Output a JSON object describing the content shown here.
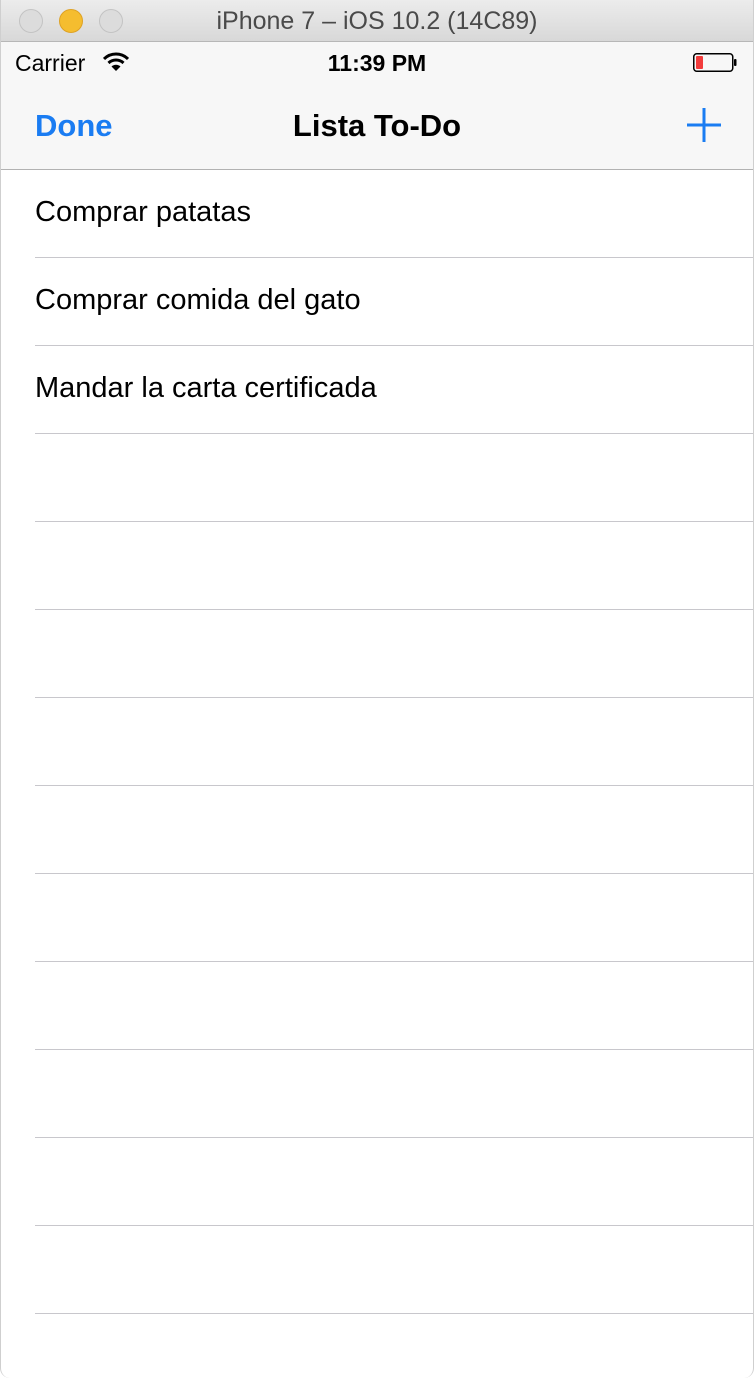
{
  "window": {
    "title": "iPhone 7 – iOS 10.2 (14C89)"
  },
  "status_bar": {
    "carrier": "Carrier",
    "time": "11:39 PM",
    "battery_color": "#f23b3b"
  },
  "nav": {
    "done_label": "Done",
    "title": "Lista To-Do",
    "accent": "#1a7cf2"
  },
  "todo_items": [
    {
      "label": "Comprar patatas"
    },
    {
      "label": "Comprar comida del gato"
    },
    {
      "label": "Mandar la carta certificada"
    },
    {
      "label": ""
    },
    {
      "label": ""
    },
    {
      "label": ""
    },
    {
      "label": ""
    },
    {
      "label": ""
    },
    {
      "label": ""
    },
    {
      "label": ""
    },
    {
      "label": ""
    },
    {
      "label": ""
    },
    {
      "label": ""
    }
  ]
}
